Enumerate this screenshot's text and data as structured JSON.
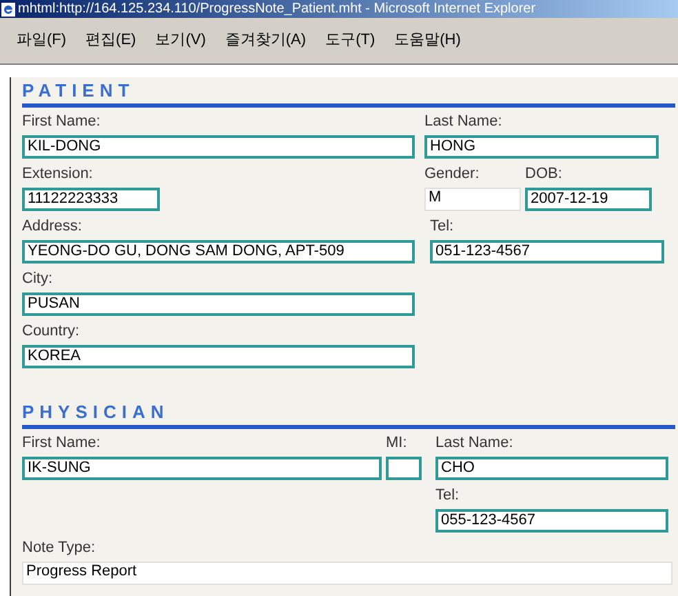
{
  "window": {
    "title": "mhtml:http://164.125.234.110/ProgressNote_Patient.mht - Microsoft Internet Explorer"
  },
  "menu": [
    "파일(F)",
    "편집(E)",
    "보기(V)",
    "즐겨찾기(A)",
    "도구(T)",
    "도움말(H)"
  ],
  "sections": [
    {
      "header": "PATIENT",
      "rows": [
        [
          {
            "label": "First Name:",
            "value": "KIL-DONG",
            "kind": "input"
          },
          {
            "label": "Last Name:",
            "value": "HONG",
            "kind": "input"
          }
        ],
        [
          {
            "label": "Extension:",
            "value": "11122223333",
            "kind": "input"
          },
          {
            "label": "Gender:",
            "value": "M",
            "kind": "plain"
          },
          {
            "label": "DOB:",
            "value": "2007-12-19",
            "kind": "input"
          }
        ],
        [
          {
            "label": "Address:",
            "value": "YEONG-DO GU, DONG SAM DONG, APT-509",
            "kind": "input"
          },
          {
            "label": "Tel:",
            "value": "051-123-4567",
            "kind": "input"
          }
        ],
        [
          {
            "label": "City:",
            "value": "PUSAN",
            "kind": "input"
          }
        ],
        [
          {
            "label": "Country:",
            "value": "KOREA",
            "kind": "input"
          }
        ]
      ]
    },
    {
      "header": "PHYSICIAN",
      "rows": [
        [
          {
            "label": "First Name:",
            "value": "IK-SUNG",
            "kind": "input"
          },
          {
            "label": "MI:",
            "kind": "input"
          },
          {
            "label": "Last Name:",
            "value": "CHO",
            "kind": "input"
          }
        ],
        [
          null,
          null,
          {
            "label": "Tel:",
            "value": "055-123-4567",
            "kind": "input"
          }
        ],
        [
          {
            "label": "Note Type:",
            "value": "Progress Report",
            "kind": "plain"
          }
        ]
      ]
    }
  ]
}
